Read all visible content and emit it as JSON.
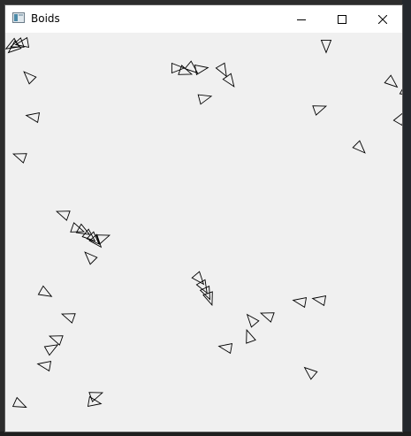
{
  "window": {
    "title": "Boids",
    "icon": "app-window-icon",
    "buttons": {
      "minimize": "minimize-icon",
      "maximize": "maximize-icon",
      "close": "close-icon"
    }
  },
  "colors": {
    "titlebar": "#ffffff",
    "canvas": "#f0f0f0",
    "boid_stroke": "#000000"
  }
}
